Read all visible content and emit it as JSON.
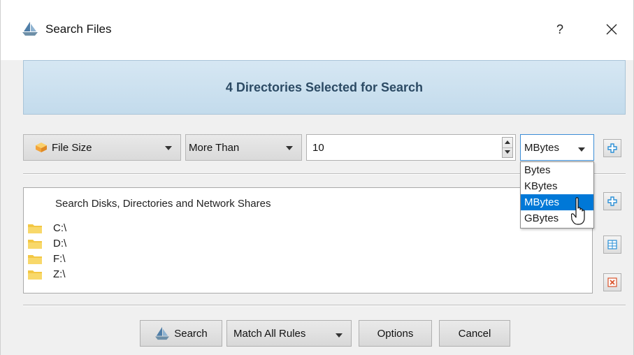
{
  "window": {
    "title": "Search Files",
    "help_label": "?"
  },
  "banner": {
    "text": "4 Directories Selected for Search"
  },
  "rule": {
    "field_label": "File Size",
    "operator_label": "More Than",
    "value": "10",
    "unit_selected": "MBytes",
    "unit_options": [
      "Bytes",
      "KBytes",
      "MBytes",
      "GBytes"
    ],
    "highlighted_option": "MBytes"
  },
  "directories": {
    "header": "Search Disks, Directories and Network Shares",
    "items": [
      "C:\\",
      "D:\\",
      "F:\\",
      "Z:\\"
    ]
  },
  "footer": {
    "search_label": "Search",
    "match_label": "Match All Rules",
    "options_label": "Options",
    "cancel_label": "Cancel"
  },
  "colors": {
    "accent": "#0078d7",
    "banner_text": "#2c4a64",
    "plus_icon": "#2a8fd6",
    "remove_icon": "#d9532b",
    "folder": "#f3c743"
  },
  "icons": {
    "app": "sailboat-icon",
    "field": "file-size-icon",
    "add": "plus-icon",
    "select_all": "grid-icon",
    "remove": "delete-icon",
    "folder": "folder-icon"
  }
}
